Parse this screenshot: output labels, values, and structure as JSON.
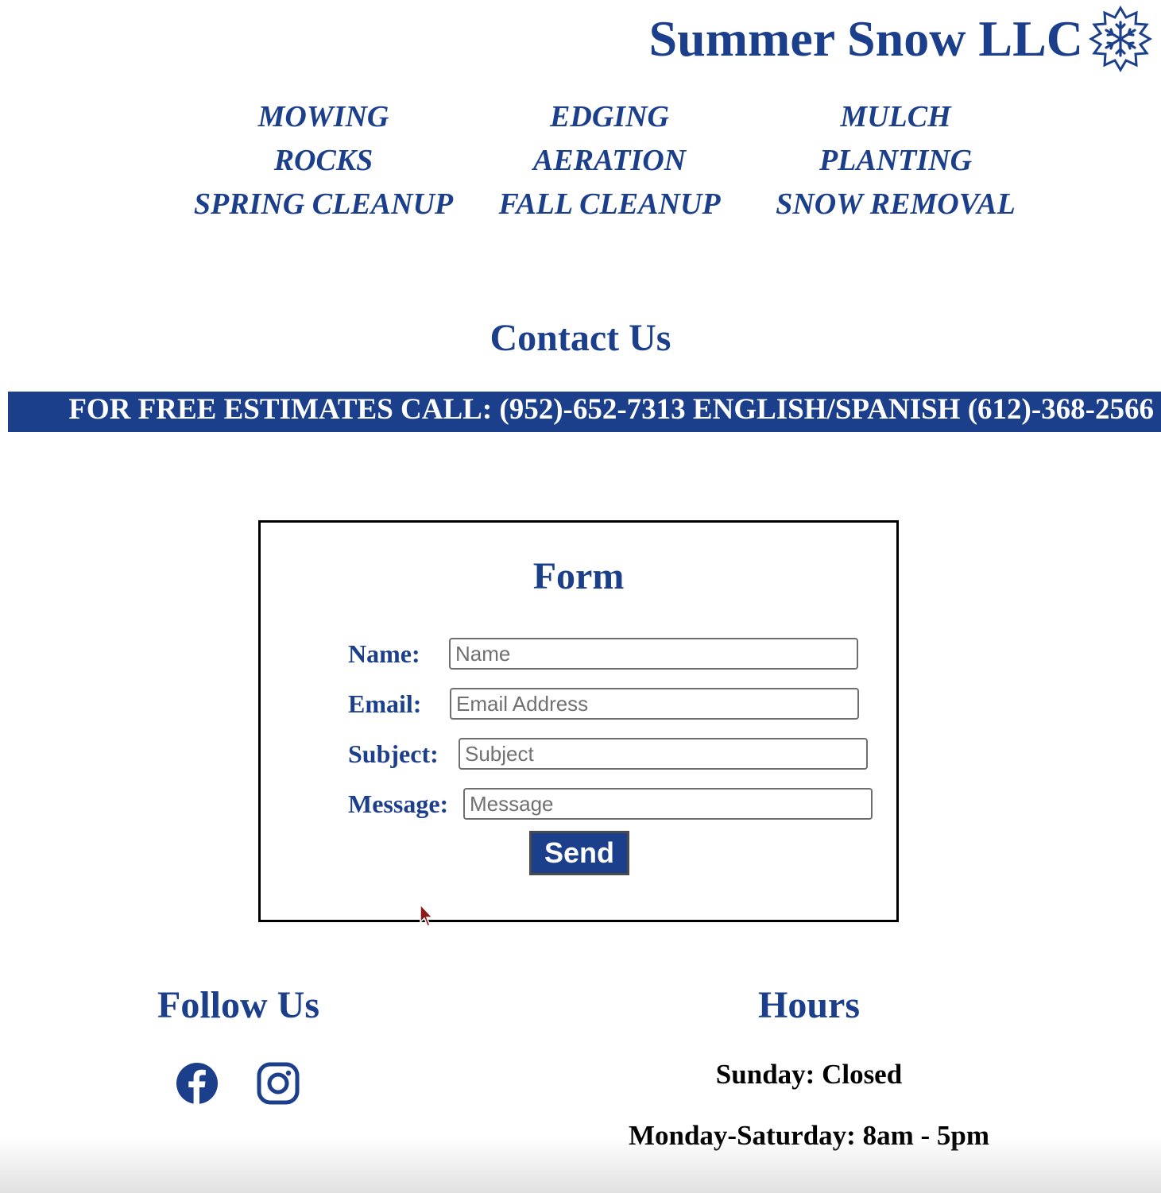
{
  "header": {
    "brand_name": "Summer Snow LLC",
    "logo_icon": "snowflake-sun-icon",
    "brand_color": "#1c3f8c"
  },
  "nav": {
    "items": [
      {
        "label": "MOWING"
      },
      {
        "label": "EDGING"
      },
      {
        "label": "MULCH"
      },
      {
        "label": "ROCKS"
      },
      {
        "label": "AERATION"
      },
      {
        "label": "PLANTING"
      },
      {
        "label": "SPRING CLEANUP"
      },
      {
        "label": "FALL CLEANUP"
      },
      {
        "label": "SNOW REMOVAL"
      }
    ]
  },
  "contact": {
    "title": "Contact Us",
    "estimate_banner": "FOR FREE ESTIMATES CALL: (952)-652-7313 ENGLISH/SPANISH (612)-368-2566"
  },
  "form": {
    "title": "Form",
    "fields": [
      {
        "label": "Name:",
        "placeholder": "Name",
        "value": ""
      },
      {
        "label": "Email:",
        "placeholder": "Email Address",
        "value": ""
      },
      {
        "label": "Subject:",
        "placeholder": "Subject",
        "value": ""
      },
      {
        "label": "Message:",
        "placeholder": "Message",
        "value": ""
      }
    ],
    "send_label": "Send"
  },
  "follow": {
    "title": "Follow Us",
    "icons": [
      "facebook-icon",
      "instagram-icon"
    ]
  },
  "hours": {
    "title": "Hours",
    "lines": [
      "Sunday: Closed",
      "Monday-Saturday: 8am - 5pm"
    ]
  }
}
